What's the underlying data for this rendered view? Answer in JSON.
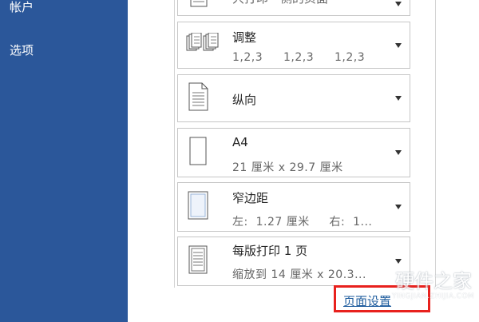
{
  "sidebar": {
    "items": [
      {
        "label": "帐户"
      },
      {
        "label": "选项"
      }
    ]
  },
  "options": {
    "top_cut": {
      "title": "只打印一侧的页面"
    },
    "collate": {
      "title": "调整",
      "subtitle_parts": [
        "1,2,3",
        "1,2,3",
        "1,2,3"
      ]
    },
    "orientation": {
      "title": "纵向"
    },
    "paper_size": {
      "title": "A4",
      "subtitle": "21 厘米 x 29.7 厘米"
    },
    "margins": {
      "title": "窄边距",
      "subtitle": "左:  1.27 厘米     右:  1..."
    },
    "pages_per_sheet": {
      "title": "每版打印 1 页",
      "subtitle": "缩放到 14 厘米 x 20.3..."
    }
  },
  "page_setup_link": "页面设置",
  "watermark": {
    "text": "硬件之家",
    "url": "YINGJIAN.ZHIJIA.COM"
  },
  "colors": {
    "sidebar": "#2b579a",
    "highlight": "#e8211d",
    "link": "#1f5d9e"
  }
}
